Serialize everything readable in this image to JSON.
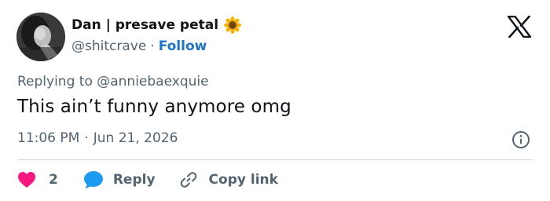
{
  "author": {
    "display_name": "Dan | presave petal",
    "name_emoji": "sunflower-icon",
    "handle": "@shitcrave",
    "separator": "·",
    "follow_label": "Follow"
  },
  "brand": {
    "logo": "x-logo-icon",
    "accent": "#1d9bf0"
  },
  "tweet": {
    "replying_to": "Replying to @anniebaexquie",
    "text": "This ain’t funny anymore omg",
    "time": "11:06 PM",
    "meta_separator": "·",
    "date": "Jun 21, 2026"
  },
  "actions": {
    "likes": "2",
    "reply_label": "Reply",
    "copy_label": "Copy link"
  },
  "colors": {
    "text_primary": "#0f1419",
    "text_secondary": "#536471",
    "heart": "#f91880",
    "reply_bubble": "#1d9bf0",
    "divider": "#cfd9de"
  }
}
